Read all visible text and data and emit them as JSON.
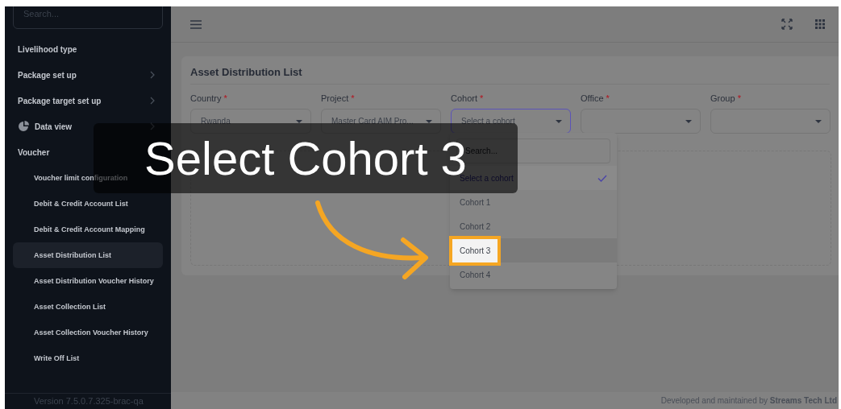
{
  "sidebar": {
    "search": {
      "placeholder": "Search..."
    },
    "items": [
      {
        "label": "Livelihood type",
        "kind": "link"
      },
      {
        "label": "Package set up",
        "kind": "group",
        "expanded": false
      },
      {
        "label": "Package target set up",
        "kind": "group",
        "expanded": false
      },
      {
        "label": "Data view",
        "kind": "icon-group",
        "expanded": false
      },
      {
        "label": "Voucher",
        "kind": "group",
        "expanded": true,
        "children": [
          {
            "label": "Voucher limit configuration",
            "selected": false
          },
          {
            "label": "Debit & Credit Account List",
            "selected": false
          },
          {
            "label": "Debit & Credit Account Mapping",
            "selected": false
          },
          {
            "label": "Asset Distribution List",
            "selected": true
          },
          {
            "label": "Asset Distribution Voucher History",
            "selected": false
          },
          {
            "label": "Asset Collection List",
            "selected": false
          },
          {
            "label": "Asset Collection Voucher History",
            "selected": false
          },
          {
            "label": "Write Off List",
            "selected": false
          }
        ]
      }
    ],
    "version": "Version 7.5.0.7.325-brac-qa"
  },
  "page": {
    "title": "Asset Distribution List",
    "filters": [
      {
        "label": "Country",
        "required_mark": "*",
        "value": "Rwanda",
        "focused": false
      },
      {
        "label": "Project",
        "required_mark": "*",
        "value": "Master Card AIM Pro...",
        "focused": false
      },
      {
        "label": "Cohort",
        "required_mark": "*",
        "value": "Select a cohort",
        "focused": true
      },
      {
        "label": "Office",
        "required_mark": "*",
        "focused": false
      },
      {
        "label": "Group",
        "required_mark": "*",
        "focused": false
      }
    ],
    "dropdown": {
      "search_placeholder": "Search...",
      "options": [
        {
          "label": "Select a cohort",
          "selected": true,
          "highlighted": false
        },
        {
          "label": "Cohort 1",
          "selected": false,
          "highlighted": false
        },
        {
          "label": "Cohort 2",
          "selected": false,
          "highlighted": false
        },
        {
          "label": "Cohort 3",
          "selected": false,
          "highlighted": true
        },
        {
          "label": "Cohort 4",
          "selected": false,
          "highlighted": false
        }
      ]
    }
  },
  "footer": "Developed and maintained by **Streams Tech Ltd**",
  "caption": "Select Cohort 3"
}
